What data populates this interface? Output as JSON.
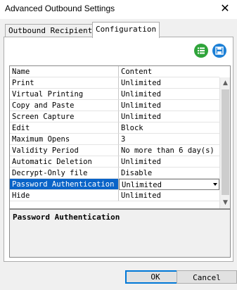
{
  "window": {
    "title": "Advanced Outbound Settings",
    "close_label": "✕"
  },
  "tabs": [
    {
      "label": "Outbound Recipients",
      "active": false
    },
    {
      "label": "Configuration",
      "active": true
    }
  ],
  "toolbar": {
    "list_icon": "list-icon",
    "save_icon": "save-icon"
  },
  "grid": {
    "headers": [
      "Name",
      "Content"
    ],
    "rows": [
      {
        "name": "Print",
        "content": "Unlimited"
      },
      {
        "name": "Virtual Printing",
        "content": "Unlimited"
      },
      {
        "name": "Copy and Paste",
        "content": "Unlimited"
      },
      {
        "name": "Screen Capture",
        "content": "Unlimited"
      },
      {
        "name": "Edit",
        "content": "Block"
      },
      {
        "name": "Maximum Opens",
        "content": "3"
      },
      {
        "name": "Validity Period",
        "content": "No more than 6 day(s)"
      },
      {
        "name": "Automatic Deletion",
        "content": "Unlimited"
      },
      {
        "name": "Decrypt-Only file",
        "content": "Disable"
      },
      {
        "name": "Password Authentication",
        "content": "Unlimited"
      },
      {
        "name": "Hide",
        "content": "Unlimited"
      }
    ],
    "selected_index": 9
  },
  "description": {
    "text": "Password Authentication"
  },
  "buttons": {
    "ok": "OK",
    "cancel": "Cancel"
  },
  "colors": {
    "selection": "#0a64c8",
    "ok_border": "#0078d7",
    "list_icon": "#2fa43a",
    "save_icon": "#1b7fd6"
  }
}
